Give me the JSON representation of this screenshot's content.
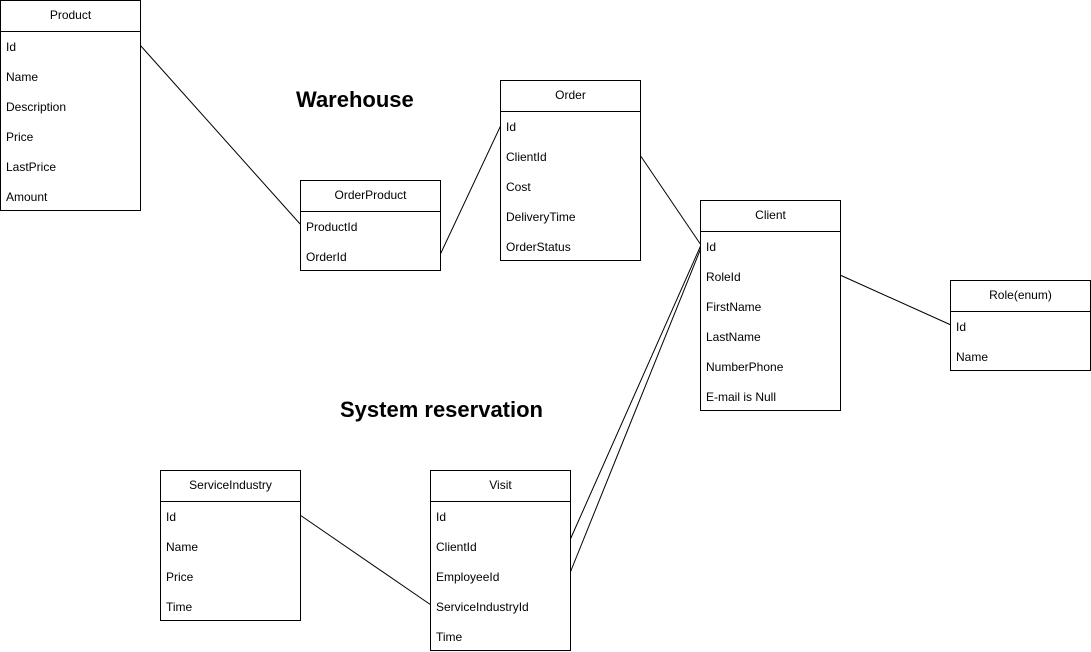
{
  "labels": {
    "warehouse": "Warehouse",
    "reservation": "System reservation"
  },
  "entities": {
    "product": {
      "title": "Product",
      "fields": [
        "Id",
        "Name",
        "Description",
        "Price",
        "LastPrice",
        "Amount"
      ]
    },
    "order_product": {
      "title": "OrderProduct",
      "fields": [
        "ProductId",
        "OrderId"
      ]
    },
    "order": {
      "title": "Order",
      "fields": [
        "Id",
        "ClientId",
        "Cost",
        "DeliveryTime",
        "OrderStatus"
      ]
    },
    "client": {
      "title": "Client",
      "fields": [
        "Id",
        "RoleId",
        "FirstName",
        "LastName",
        "NumberPhone",
        "E-mail is Null"
      ]
    },
    "role": {
      "title": "Role(enum)",
      "fields": [
        "Id",
        "Name"
      ]
    },
    "service_industry": {
      "title": "ServiceIndustry",
      "fields": [
        "Id",
        "Name",
        "Price",
        "Time"
      ]
    },
    "visit": {
      "title": "Visit",
      "fields": [
        "Id",
        "ClientId",
        "EmployeeId",
        "ServiceIndustryId",
        "Time"
      ]
    }
  },
  "colors": {
    "line": "#000000",
    "background": "#ffffff"
  }
}
